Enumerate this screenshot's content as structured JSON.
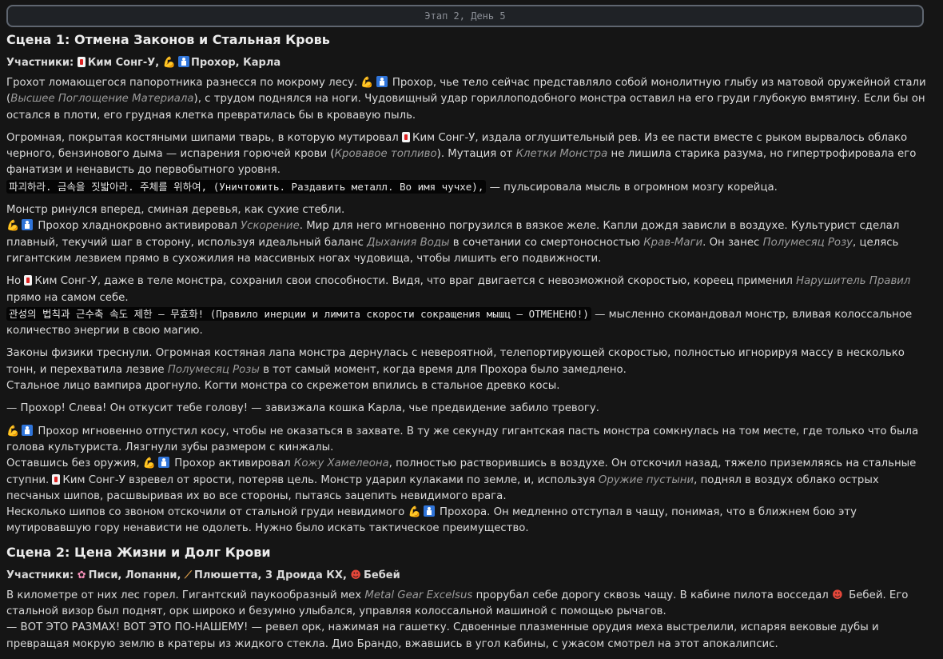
{
  "stage_label": "Этап 2, День 5",
  "scene1": {
    "title": "Сцена 1: Отмена Законов и Стальная Кровь",
    "participants_label": "Участники:",
    "p_kim": "Ким Сонг-У,",
    "p_prokhor": "Прохор, Карла",
    "para1_a": " Прохор, чье тело сейчас представляло собой монолитную глыбу из матовой оружейной стали (",
    "para1_i": "Высшее Поглощение Материала",
    "para1_b": "), с трудом поднялся на ноги. Чудовищный удар гориллоподобного монстра оставил на его груди глубокую вмятину. Если бы он остался в плоти, его грудная клетка превратилась бы в кровавую пыль.",
    "para1_lead": "Грохот ломающегося папоротника разнесся по мокрому лесу.",
    "para2_a": "Огромная, покрытая костяными шипами тварь, в которую мутировал ",
    "para2_kim": "Ким Сонг-У, издала оглушительный рев. Из ее пасти вместе с рыком вырвалось облако черного, бензинового дыма — испарения горючей крови (",
    "para2_i1": "Кровавое топливо",
    "para2_b": "). Мутация от ",
    "para2_i2": "Клетки Монстра",
    "para2_c": " не лишила старика разума, но гипертрофировала его фанатизм и ненависть до первобытного уровня.",
    "code1": "파괴하라. 금속을 짓밟아라. 주체를 위하여, (Уничтожить. Раздавить металл. Во имя чучхе),",
    "code1_after": " — пульсировала мысль в огромном мозгу корейца.",
    "para3_a": "Монстр ринулся вперед, сминая деревья, как сухие стебли.",
    "para3_b": " Прохор хладнокровно активировал ",
    "para3_i1": "Ускорение",
    "para3_c": ". Мир для него мгновенно погрузился в вязкое желе. Капли дождя зависли в воздухе. Культурист сделал плавный, текучий шаг в сторону, используя идеальный баланс ",
    "para3_i2": "Дыхания Воды",
    "para3_d": " в сочетании со смертоносностью ",
    "para3_i3": "Крав-Маги",
    "para3_e": ". Он занес ",
    "para3_i4": "Полумесяц Розу",
    "para3_f": ", целясь гигантским лезвием прямо в сухожилия на массивных ногах чудовища, чтобы лишить его подвижности.",
    "para4_a": "Но ",
    "para4_b": "Ким Сонг-У, даже в теле монстра, сохранил свои способности. Видя, что враг двигается с невозможной скоростью, кореец применил ",
    "para4_i": "Нарушитель Правил",
    "para4_c": " прямо на самом себе.",
    "code2": "관성의 법칙과 근수축 속도 제한 – 무효화! (Правило инерции и лимита скорости сокращения мышц – ОТМЕНЕНО!)",
    "code2_after": " — мысленно скомандовал монстр, вливая колоссальное количество энергии в свою магию.",
    "para5_a": "Законы физики треснули. Огромная костяная лапа монстра дернулась с невероятной, телепортирующей скоростью, полностью игнорируя массу в несколько тонн, и перехватила лезвие ",
    "para5_i": "Полумесяц Розы",
    "para5_b": " в тот самый момент, когда время для Прохора было замедлено.",
    "para5_c": "Стальное лицо вампира дрогнуло. Когти монстра со скрежетом впились в стальное древко косы.",
    "para6": "— Прохор! Слева! Он откусит тебе голову! — завизжала кошка Карла, чье предвидение забило тревогу.",
    "para7_a": " Прохор мгновенно отпустил косу, чтобы не оказаться в захвате. В ту же секунду гигантская пасть монстра сомкнулась на том месте, где только что была голова культуриста. Лязгнули зубы размером с кинжалы.",
    "para7_b": "Оставшись без оружия, ",
    "para7_c": " Прохор активировал ",
    "para7_i1": "Кожу Хамелеона",
    "para7_d": ", полностью растворившись в воздухе. Он отскочил назад, тяжело приземляясь на стальные ступни. ",
    "para7_e": "Ким Сонг-У взревел от ярости, потеряв цель. Монстр ударил кулаками по земле, и, используя ",
    "para7_i2": "Оружие пустыни",
    "para7_f": ", поднял в воздух облако острых песчаных шипов, расшвыривая их во все стороны, пытаясь зацепить невидимого врага.",
    "para7_g": "Несколько шипов со звоном отскочили от стальной груди невидимого ",
    "para7_h": " Прохора. Он медленно отступал в чащу, понимая, что в ближнем бою эту мутировавшую гору ненависти не одолеть. Нужно было искать тактическое преимущество."
  },
  "scene2": {
    "title": "Сцена 2: Цена Жизни и Долг Крови",
    "participants_label": "Участники:",
    "p1": "Писи, Лопанни,",
    "p2": "Плюшетта, 3 Дроида КХ,",
    "p3": "Бебей",
    "para1_a": "В километре от них лес горел. Гигантский паукообразный мех ",
    "para1_i": "Metal Gear Excelsus",
    "para1_b": " прорубал себе дорогу сквозь чащу. В кабине пилота восседал ",
    "para1_c": " Бебей. Его стальной визор был поднят, орк широко и безумно улыбался, управляя колоссальной машиной с помощью рычагов.",
    "para1_d": "— ВОТ ЭТО РАЗМАХ! ВОТ ЭТО ПО-НАШЕМУ! — ревел орк, нажимая на гашетку. Сдвоенные плазменные орудия меха выстрелили, испаряя вековые дубы и превращая мокрую землю в кратеры из жидкого стекла. Дио Брандо, вжавшись в угол кабины, с ужасом смотрел на этот апокалипсис."
  },
  "icons": [
    "mahjong-icon",
    "muscle-icon",
    "man-icon",
    "blossom-icon",
    "broom-icon",
    "imp-icon"
  ]
}
